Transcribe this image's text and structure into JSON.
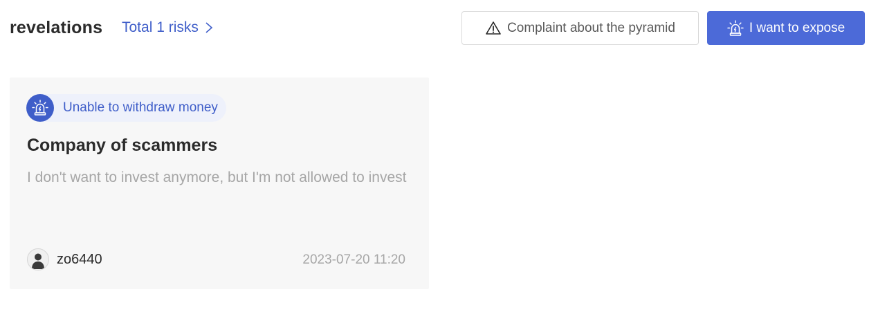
{
  "header": {
    "title": "revelations",
    "total_risks": "Total 1 risks",
    "complaint_button": "Complaint about the pyramid",
    "expose_button": "I want to expose"
  },
  "card": {
    "tag": "Unable to withdraw money",
    "title": "Company of scammers",
    "description": "I don't want to invest anymore, but I'm not allowed to invest",
    "author": "zo6440",
    "timestamp": "2023-07-20 11:20"
  },
  "icons": {
    "complaint": "warning-triangle-icon",
    "expose": "alarm-siren-icon",
    "tag": "alarm-siren-icon",
    "total_risks": "chevron-right-icon",
    "avatar": "user-silhouette-icon"
  },
  "colors": {
    "accent": "#3f5ec9",
    "primary_button": "#4c6ad8",
    "card_background": "#f7f7f7",
    "muted_text": "#a6a6a6"
  }
}
